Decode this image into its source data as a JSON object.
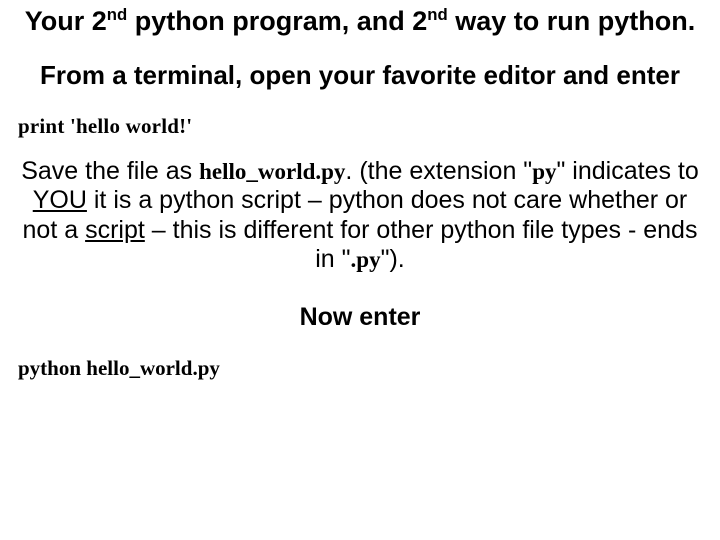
{
  "title": {
    "part1": "Your 2",
    "sup1": "nd",
    "part2": " python program, and 2",
    "sup2": "nd",
    "part3": " way to run python."
  },
  "subtitle": "From a terminal, open your favorite editor and enter",
  "code1": "print 'hello world!'",
  "body": {
    "t1": "Save the file as ",
    "file": "hello_world.py",
    "t2": ". (the extension \"",
    "ext1": "py",
    "t3": "\" indicates to ",
    "you": "YOU",
    "t4": " it is a python script – python does not care whether or not a ",
    "script": "script",
    "t5": " – this is different for other python file types - ends in \"",
    "ext2": ".py",
    "t6": "\")."
  },
  "nowenter": "Now enter",
  "code2": "python hello_world.py"
}
